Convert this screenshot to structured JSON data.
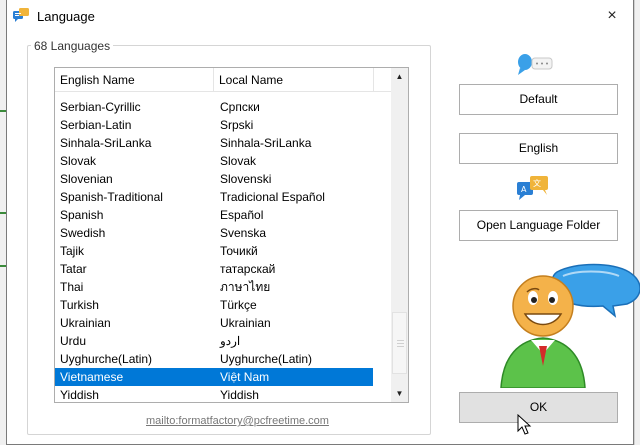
{
  "window": {
    "title": "Language",
    "close_glyph": "×"
  },
  "group": {
    "legend": "68 Languages"
  },
  "list": {
    "columns": [
      "English Name",
      "Local Name"
    ],
    "rows": [
      {
        "english": "Serbian-Cyrillic",
        "local": "Српски"
      },
      {
        "english": "Serbian-Latin",
        "local": "Srpski"
      },
      {
        "english": "Sinhala-SriLanka",
        "local": "Sinhala-SriLanka"
      },
      {
        "english": "Slovak",
        "local": "Slovak"
      },
      {
        "english": "Slovenian",
        "local": "Slovenski"
      },
      {
        "english": "Spanish-Traditional",
        "local": "Tradicional Español"
      },
      {
        "english": "Spanish",
        "local": "Español"
      },
      {
        "english": "Swedish",
        "local": "Svenska"
      },
      {
        "english": "Tajik",
        "local": "Точикй"
      },
      {
        "english": "Tatar",
        "local": "татарскай"
      },
      {
        "english": "Thai",
        "local": "ภาษาไทย"
      },
      {
        "english": "Turkish",
        "local": "Türkçe"
      },
      {
        "english": "Ukrainian",
        "local": "Ukrainian"
      },
      {
        "english": "Urdu",
        "local": "اردو"
      },
      {
        "english": "Uyghurche(Latin)",
        "local": "Uyghurche(Latin)"
      },
      {
        "english": "Vietnamese",
        "local": "Việt Nam",
        "selected": true
      },
      {
        "english": "Yiddish",
        "local": "Yiddish"
      }
    ],
    "scroll_up_glyph": "▲",
    "scroll_down_glyph": "▼"
  },
  "footer": {
    "mailto": "mailto:formatfactory@pcfreetime.com"
  },
  "buttons": {
    "default_label": "Default",
    "english_label": "English",
    "open_folder_label": "Open Language Folder",
    "ok_label": "OK"
  },
  "icons": {
    "app": "language-app-icon",
    "speech1": "speech-bubble-icon",
    "speech2": "language-chat-icon",
    "mascot": "smiling-person-chat-mascot",
    "cursor": "mouse-pointer-icon"
  },
  "colors": {
    "selection": "#0078d7",
    "ok_button": "#e1e1e1",
    "mascot_green": "#5cc24a",
    "bubble_blue": "#3aa0e8"
  }
}
